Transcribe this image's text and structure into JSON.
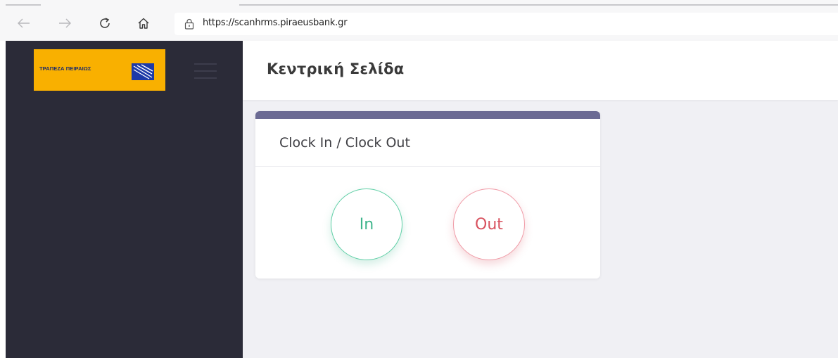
{
  "browser": {
    "url": "https://scanhrms.piraeusbank.gr",
    "icons": {
      "back": "arrow-left",
      "forward": "arrow-right",
      "reload": "reload",
      "home": "home",
      "lock": "lock"
    }
  },
  "sidebar": {
    "logo_text": "ΤΡΑΠΕΖΑ ΠΕΙΡΑΙΩΣ",
    "logo_color": "#f9b000",
    "background": "#2b2b38"
  },
  "header": {
    "title": "Κεντρική Σελίδα"
  },
  "clock_card": {
    "title": "Clock In / Clock Out",
    "accent": "#6b6a93",
    "in_label": "In",
    "out_label": "Out",
    "in_color": "#3fb58c",
    "out_color": "#d8525f"
  }
}
